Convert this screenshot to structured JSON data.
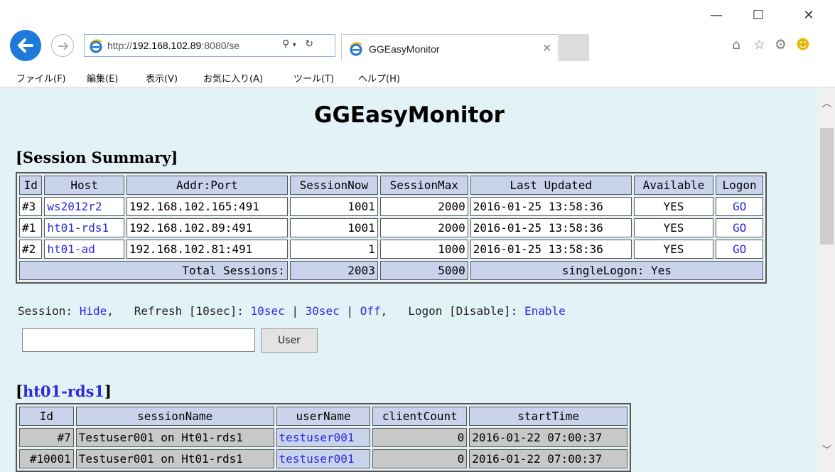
{
  "browser": {
    "url_prefix": "http://",
    "url_host": "192.168.102.89",
    "url_rest": ":8080/se",
    "tab_title": "GGEasyMonitor",
    "window_buttons": [
      "—",
      "☐",
      "✕"
    ],
    "menu": [
      "ファイル(F)",
      "編集(E)",
      "表示(V)",
      "お気に入り(A)",
      "ツール(T)",
      "ヘルプ(H)"
    ]
  },
  "page": {
    "title": "GGEasyMonitor",
    "summary_heading": "[Session Summary]",
    "summary_columns": [
      "Id",
      "Host",
      "Addr:Port",
      "SessionNow",
      "SessionMax",
      "Last Updated",
      "Available",
      "Logon"
    ],
    "summary_rows": [
      [
        "#3",
        "ws2012r2",
        "192.168.102.165:491",
        "1001",
        "2000",
        "2016-01-25 13:58:36",
        "YES",
        "GO"
      ],
      [
        "#1",
        "ht01-rds1",
        "192.168.102.89:491",
        "1001",
        "2000",
        "2016-01-25 13:58:36",
        "YES",
        "GO"
      ],
      [
        "#2",
        "ht01-ad",
        "192.168.102.81:491",
        "1",
        "1000",
        "2016-01-25 13:58:36",
        "YES",
        "GO"
      ]
    ],
    "total_label": "Total Sessions:",
    "total_now": "2003",
    "total_max": "5000",
    "single_logon": "singleLogon: Yes",
    "options": {
      "session_label": "Session:",
      "session_hide": "Hide",
      "comma": ",",
      "refresh_label": "Refresh [10sec]:",
      "r10": "10sec",
      "r30": "30sec",
      "off": "Off",
      "sep": "|",
      "logon_label": "Logon [Disable]:",
      "enable": "Enable"
    },
    "user_input_value": "",
    "user_button": "User",
    "host_heading_open": "[",
    "host_heading_name": "ht01-rds1",
    "host_heading_close": "]",
    "session_columns": [
      "Id",
      "sessionName",
      "userName",
      "clientCount",
      "startTime"
    ],
    "session_rows": [
      [
        "#7",
        "Testuser001 on Ht01-rds1",
        "testuser001",
        "0",
        "2016-01-22 07:00:37"
      ],
      [
        "#10001",
        "Testuser001 on Ht01-rds1",
        "testuser001",
        "0",
        "2016-01-22 07:00:37"
      ]
    ]
  }
}
